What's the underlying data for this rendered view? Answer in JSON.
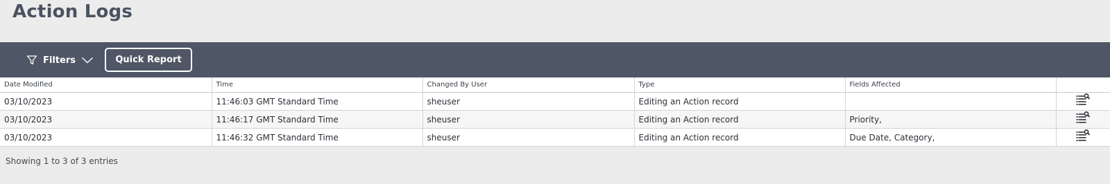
{
  "page": {
    "title": "Action Logs"
  },
  "toolbar": {
    "filters_label": "Filters",
    "filter_icon": "filter-funnel-icon",
    "chevron_icon": "chevron-down-icon",
    "quick_report_label": "Quick Report"
  },
  "table": {
    "columns": [
      "Date Modified",
      "Time",
      "Changed By User",
      "Type",
      "Fields Affected",
      ""
    ],
    "rows": [
      {
        "date": "03/10/2023",
        "time": "11:46:03 GMT Standard Time",
        "user": "sheuser",
        "type": "Editing an Action record",
        "fields": ""
      },
      {
        "date": "03/10/2023",
        "time": "11:46:17 GMT Standard Time",
        "user": "sheuser",
        "type": "Editing an Action record",
        "fields": "Priority,"
      },
      {
        "date": "03/10/2023",
        "time": "11:46:32 GMT Standard Time",
        "user": "sheuser",
        "type": "Editing an Action record",
        "fields": "Due Date, Category,"
      }
    ],
    "row_action_icon": "view-details-icon"
  },
  "footer": {
    "info": "Showing 1 to 3 of 3 entries"
  },
  "colors": {
    "toolbar_bg": "#4f5766",
    "page_bg": "#ececec",
    "title": "#4b5361"
  }
}
